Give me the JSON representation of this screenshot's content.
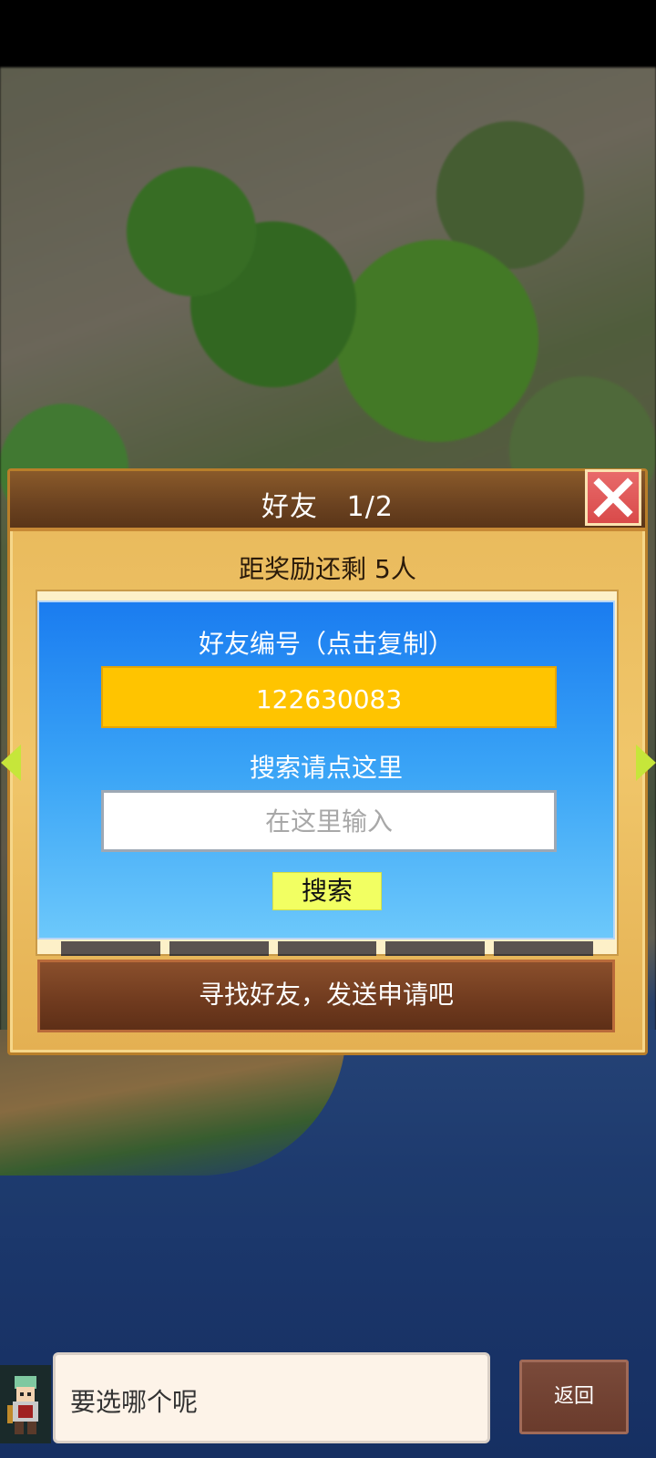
{
  "dialog": {
    "title": "好友   1/2",
    "reward_progress": "距奖励还剩 5人",
    "friend_id_label": "好友编号（点击复制）",
    "friend_id": "122630083",
    "search_hint": "搜索请点这里",
    "search_placeholder": "在这里输入",
    "search_button": "搜索",
    "find_friends_button": "寻找好友，发送申请吧",
    "close_icon": "close-x-icon",
    "nav_icons": [
      "arrow-left-icon",
      "arrow-right-icon"
    ]
  },
  "bottom": {
    "message": "要选哪个呢",
    "back_button": "返回"
  },
  "colors": {
    "panel_blue": "#1a7cf0",
    "id_box": "#ffc400",
    "search_button": "#f2ff62",
    "close_red": "#d94a4a",
    "header_brown": "#6b4220"
  }
}
